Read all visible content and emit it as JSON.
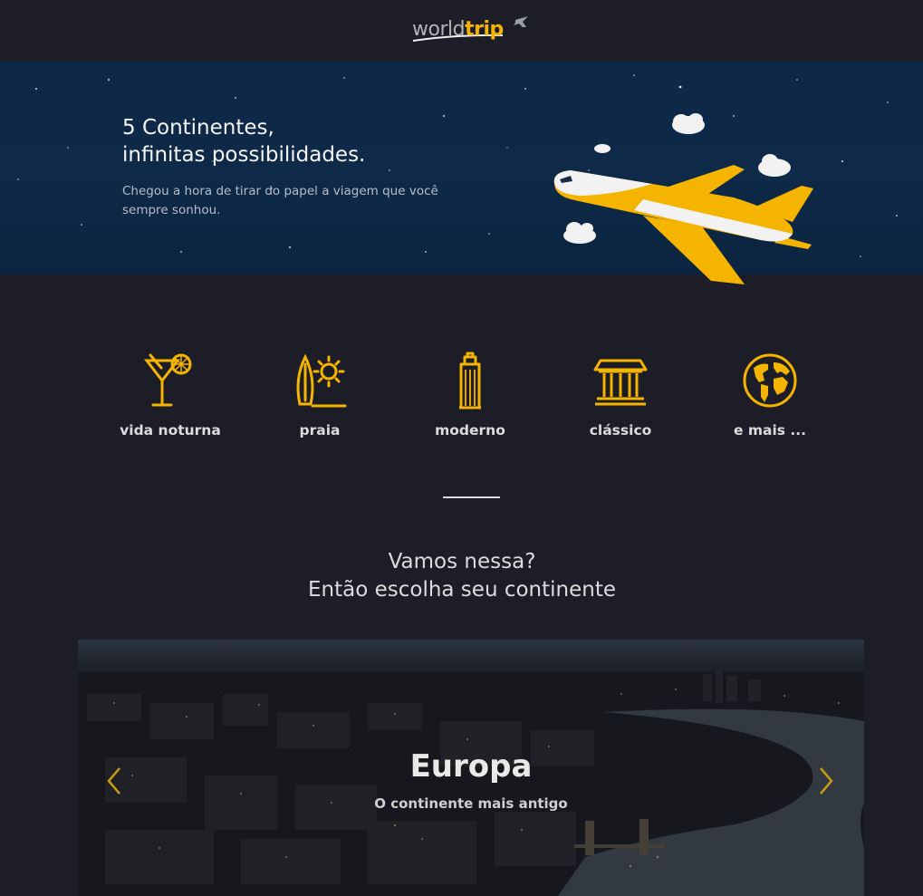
{
  "header": {
    "logo_world": "world",
    "logo_trip": "trip"
  },
  "banner": {
    "title_line1": "5 Continentes,",
    "title_line2": "infinitas possibilidades.",
    "subtitle": "Chegou a hora de tirar do papel a viagem que você sempre sonhou."
  },
  "categories": [
    {
      "label": "vida noturna",
      "icon": "cocktail-icon"
    },
    {
      "label": "praia",
      "icon": "surfboard-sun-icon"
    },
    {
      "label": "moderno",
      "icon": "skyscraper-icon"
    },
    {
      "label": "clássico",
      "icon": "museum-icon"
    },
    {
      "label": "e mais ...",
      "icon": "globe-icon"
    }
  ],
  "cta": {
    "line1": "Vamos nessa?",
    "line2": "Então escolha seu continente"
  },
  "slider": {
    "title": "Europa",
    "subtitle": "O continente mais antigo",
    "prev_icon": "chevron-left-icon",
    "next_icon": "chevron-right-icon"
  },
  "colors": {
    "background": "#1c1d26",
    "accent": "#f5b400",
    "text": "#dadada",
    "banner": "#0d2748"
  }
}
